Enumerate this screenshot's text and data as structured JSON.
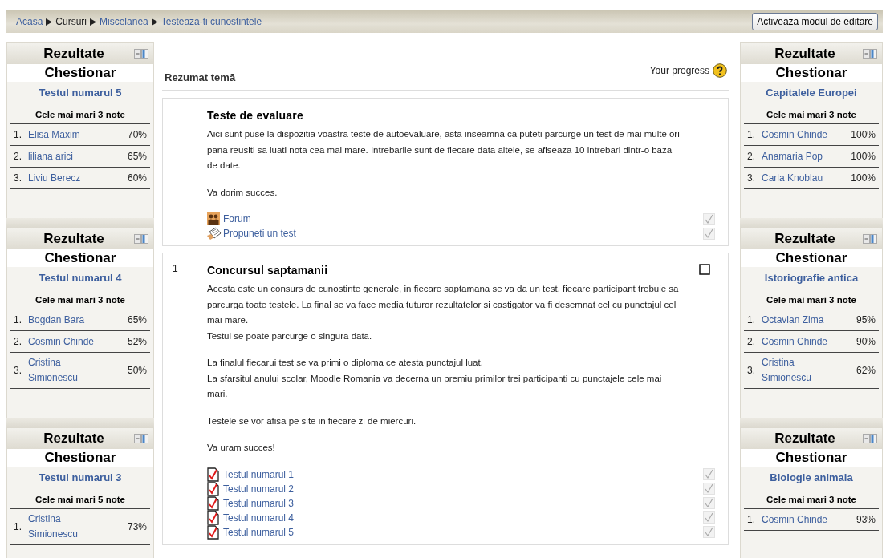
{
  "breadcrumb": [
    {
      "label": "Acasă",
      "link": true
    },
    {
      "label": "Cursuri",
      "link": false
    },
    {
      "label": "Miscelanea",
      "link": true
    },
    {
      "label": "Testeaza-ti cunostintele",
      "link": true
    }
  ],
  "edit_button": "Activează modul de editare",
  "left_blocks": [
    {
      "header": "Rezultate",
      "title": "Chestionar",
      "quiz": "Testul numarul 5",
      "subtitle": "Cele mai mari 3 note",
      "rows": [
        {
          "rank": "1.",
          "name": "Elisa Maxim",
          "score": "70%"
        },
        {
          "rank": "2.",
          "name": "liliana arici",
          "score": "65%"
        },
        {
          "rank": "3.",
          "name": "Liviu Berecz",
          "score": "60%"
        }
      ]
    },
    {
      "header": "Rezultate",
      "title": "Chestionar",
      "quiz": "Testul numarul 4",
      "subtitle": "Cele mai mari 3 note",
      "rows": [
        {
          "rank": "1.",
          "name": "Bogdan Bara",
          "score": "65%"
        },
        {
          "rank": "2.",
          "name": "Cosmin Chinde",
          "score": "52%"
        },
        {
          "rank": "3.",
          "name": "Cristina Simionescu",
          "score": "50%"
        }
      ]
    },
    {
      "header": "Rezultate",
      "title": "Chestionar",
      "quiz": "Testul numarul 3",
      "subtitle": "Cele mai mari 5 note",
      "rows": [
        {
          "rank": "1.",
          "name": "Cristina Simionescu",
          "score": "73%"
        }
      ]
    }
  ],
  "summary": {
    "title": "Rezumat temă",
    "progress": "Your progress"
  },
  "sections": [
    {
      "title": "Teste de evaluare",
      "paragraphs": [
        [
          "Aici sunt puse la dispozitia voastra teste de autoevaluare, asta inseamna ca puteti parcurge un test de mai multe ori pana reusiti sa luati nota cea mai mare. Intrebarile sunt de fiecare data altele, se afiseaza 10 intrebari dintr-o baza de date."
        ],
        [
          "Va dorim succes."
        ]
      ],
      "activities": [
        {
          "kind": "forum",
          "label": "Forum"
        },
        {
          "kind": "assignment",
          "label": "Propuneti un test"
        }
      ]
    },
    {
      "number": "1",
      "title": "Concursul saptamanii",
      "paragraphs": [
        [
          "Acesta este un consurs de cunostinte generale, in fiecare saptamana se va da un test, fiecare participant trebuie sa parcurga toate testele. La final se va face media tuturor rezultatelor si castigator va fi desemnat cel cu punctajul cel mai mare.",
          "Testul se poate parcurge o singura data."
        ],
        [
          "La finalul fiecarui test se va primi o diploma ce atesta punctajul luat.",
          "La sfarsitul anului scolar, Moodle Romania va decerna un premiu primilor trei participanti cu punctajele cele mai mari."
        ],
        [
          "Testele se vor afisa pe site in fiecare zi de miercuri."
        ],
        [
          "Va uram succes!"
        ]
      ],
      "activities": [
        {
          "kind": "quiz",
          "label": "Testul numarul 1"
        },
        {
          "kind": "quiz",
          "label": "Testul numarul 2"
        },
        {
          "kind": "quiz",
          "label": "Testul numarul 3"
        },
        {
          "kind": "quiz",
          "label": "Testul numarul 4"
        },
        {
          "kind": "quiz",
          "label": "Testul numarul 5"
        }
      ]
    }
  ],
  "right_blocks": [
    {
      "header": "Rezultate",
      "title": "Chestionar",
      "quiz": "Capitalele Europei",
      "subtitle": "Cele mai mari 3 note",
      "rows": [
        {
          "rank": "1.",
          "name": "Cosmin Chinde",
          "score": "100%"
        },
        {
          "rank": "2.",
          "name": "Anamaria Pop",
          "score": "100%"
        },
        {
          "rank": "3.",
          "name": "Carla Knoblau",
          "score": "100%"
        }
      ]
    },
    {
      "header": "Rezultate",
      "title": "Chestionar",
      "quiz": "Istoriografie antica",
      "subtitle": "Cele mai mari 3 note",
      "rows": [
        {
          "rank": "1.",
          "name": "Octavian Zima",
          "score": "95%"
        },
        {
          "rank": "2.",
          "name": "Cosmin Chinde",
          "score": "90%"
        },
        {
          "rank": "3.",
          "name": "Cristina Simionescu",
          "score": "62%"
        }
      ]
    },
    {
      "header": "Rezultate",
      "title": "Chestionar",
      "quiz": "Biologie animala",
      "subtitle": "Cele mai mari 3 note",
      "rows": [
        {
          "rank": "1.",
          "name": "Cosmin Chinde",
          "score": "93%"
        }
      ]
    }
  ]
}
